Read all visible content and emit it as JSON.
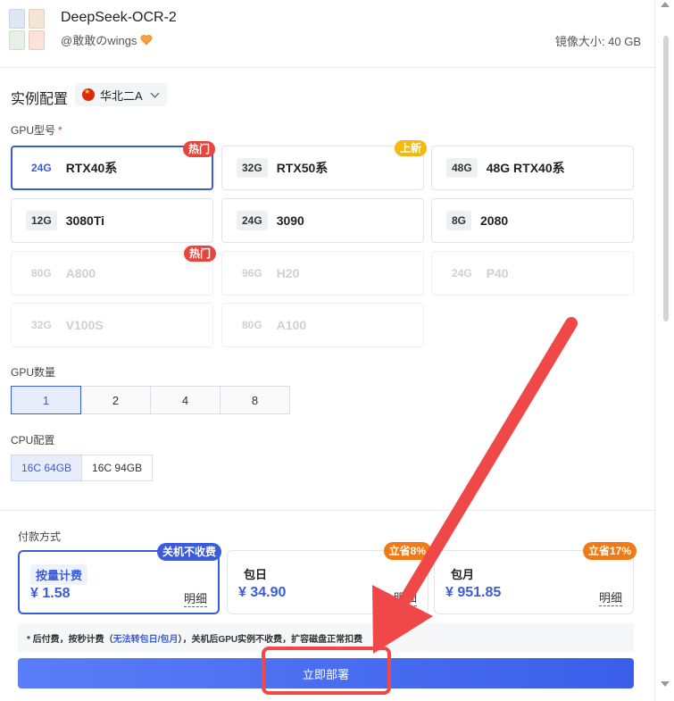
{
  "header": {
    "title": "DeepSeek-OCR-2",
    "author": "@敢敢のwings",
    "image_size": "镜像大小: 40 GB"
  },
  "instance": {
    "title": "实例配置",
    "region": "华北二A"
  },
  "gpu_type": {
    "label": "GPU型号",
    "required_mark": "*",
    "cards": [
      {
        "mem": "24G",
        "name": "RTX40系",
        "tag": "热门"
      },
      {
        "mem": "32G",
        "name": "RTX50系",
        "tag": "上新"
      },
      {
        "mem": "48G",
        "name": "48G RTX40系",
        "tag": ""
      },
      {
        "mem": "12G",
        "name": "3080Ti",
        "tag": ""
      },
      {
        "mem": "24G",
        "name": "3090",
        "tag": ""
      },
      {
        "mem": "8G",
        "name": "2080",
        "tag": ""
      },
      {
        "mem": "80G",
        "name": "A800",
        "tag": "热门"
      },
      {
        "mem": "96G",
        "name": "H20",
        "tag": ""
      },
      {
        "mem": "24G",
        "name": "P40",
        "tag": ""
      },
      {
        "mem": "32G",
        "name": "V100S",
        "tag": ""
      },
      {
        "mem": "80G",
        "name": "A100",
        "tag": ""
      }
    ]
  },
  "gpu_count": {
    "label": "GPU数量",
    "options": [
      "1",
      "2",
      "4",
      "8"
    ]
  },
  "cpu": {
    "label": "CPU配置",
    "options": [
      "16C 64GB",
      "16C 94GB"
    ]
  },
  "payment": {
    "label": "付款方式",
    "options": [
      {
        "name": "按量计费",
        "price": "¥ 1.58",
        "detail": "明细",
        "tag": "关机不收费"
      },
      {
        "name": "包日",
        "price": "¥ 34.90",
        "detail": "明细",
        "tag": "立省8%"
      },
      {
        "name": "包月",
        "price": "¥ 951.85",
        "detail": "明细",
        "tag": "立省17%"
      }
    ],
    "note_prefix": "* 后付费，按秒计费（",
    "note_em": "无法转包日/包月",
    "note_suffix": "），关机后GPU实例不收费，扩容磁盘正常扣费"
  },
  "deploy_label": "立即部署",
  "colors": {
    "accent": "#3b5bdb",
    "hot": "#e8453c",
    "new": "#f5b80f",
    "save": "#f07a16",
    "annotation": "#f04848"
  }
}
